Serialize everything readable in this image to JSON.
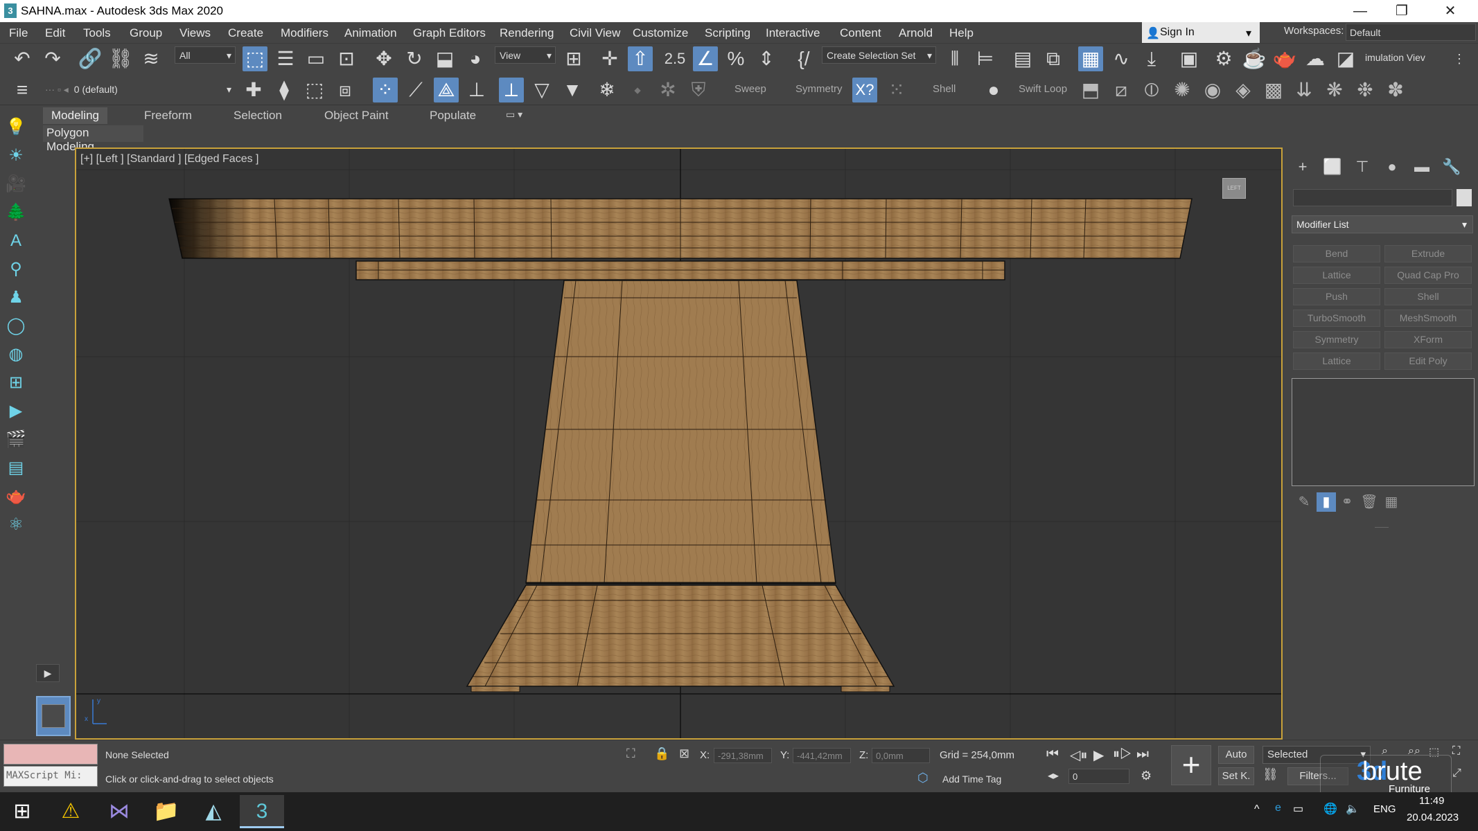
{
  "window": {
    "title": "SAHNA.max - Autodesk 3ds Max 2020",
    "app_icon": "3",
    "minimize": "—",
    "restore": "❐",
    "close": "✕"
  },
  "menu": [
    "File",
    "Edit",
    "Tools",
    "Group",
    "Views",
    "Create",
    "Modifiers",
    "Animation",
    "Graph Editors",
    "Rendering",
    "Civil View",
    "Customize",
    "Scripting",
    "Interactive",
    "Content",
    "Arnold",
    "Help"
  ],
  "signin": {
    "label": "Sign In",
    "arrow": "▾"
  },
  "workspaces": {
    "label": "Workspaces:",
    "value": "Default"
  },
  "toolbar": {
    "filter_value": "All",
    "refcoord_value": "View",
    "selection_set_value": "Create Selection Set",
    "snap_value": "2.5",
    "simulation_view_label": "imulation Viev",
    "layer_value": "0 (default)"
  },
  "ribbon_tools": {
    "sweep": "Sweep",
    "symmetry": "Symmetry",
    "shell": "Shell",
    "swift_loop": "Swift Loop"
  },
  "ribbon": {
    "tabs": [
      "Modeling",
      "Freeform",
      "Selection",
      "Object Paint",
      "Populate"
    ],
    "panel_label": "Polygon Modeling"
  },
  "viewport": {
    "label": "[+] [Left ] [Standard ] [Edged Faces ]",
    "viewcube_label": "LEFT",
    "axis_x": "x",
    "axis_y": "y"
  },
  "command_panel": {
    "modifier_list": "Modifier List",
    "modifier_buttons": [
      "Bend",
      "Extrude",
      "Lattice",
      "Quad Cap Pro",
      "Push",
      "Shell",
      "TurboSmooth",
      "MeshSmooth",
      "Symmetry",
      "XForm",
      "Lattice",
      "Edit Poly"
    ]
  },
  "status": {
    "maxscript": "MAXScript Mi:",
    "selection": "None Selected",
    "prompt": "Click or click-and-drag to select objects",
    "x_label": "X:",
    "x_value": "-291,38mm",
    "y_label": "Y:",
    "y_value": "-441,42mm",
    "z_label": "Z:",
    "z_value": "0,0mm",
    "grid": "Grid = 254,0mm",
    "add_time_tag": "Add Time Tag",
    "auto": "Auto",
    "selected": "Selected",
    "setk": "Set K.",
    "filters": "Filters...",
    "frame": "0"
  },
  "taskbar": {
    "lang": "ENG",
    "time": "11:49",
    "date": "20.04.2023"
  },
  "watermark": {
    "brand_3d": "3d",
    "brand": "brute",
    "sub": "Furniture"
  },
  "colors": {
    "accent": "#5d8ac0",
    "viewport_border": "#c9a23a",
    "wood": "#a07c50"
  }
}
